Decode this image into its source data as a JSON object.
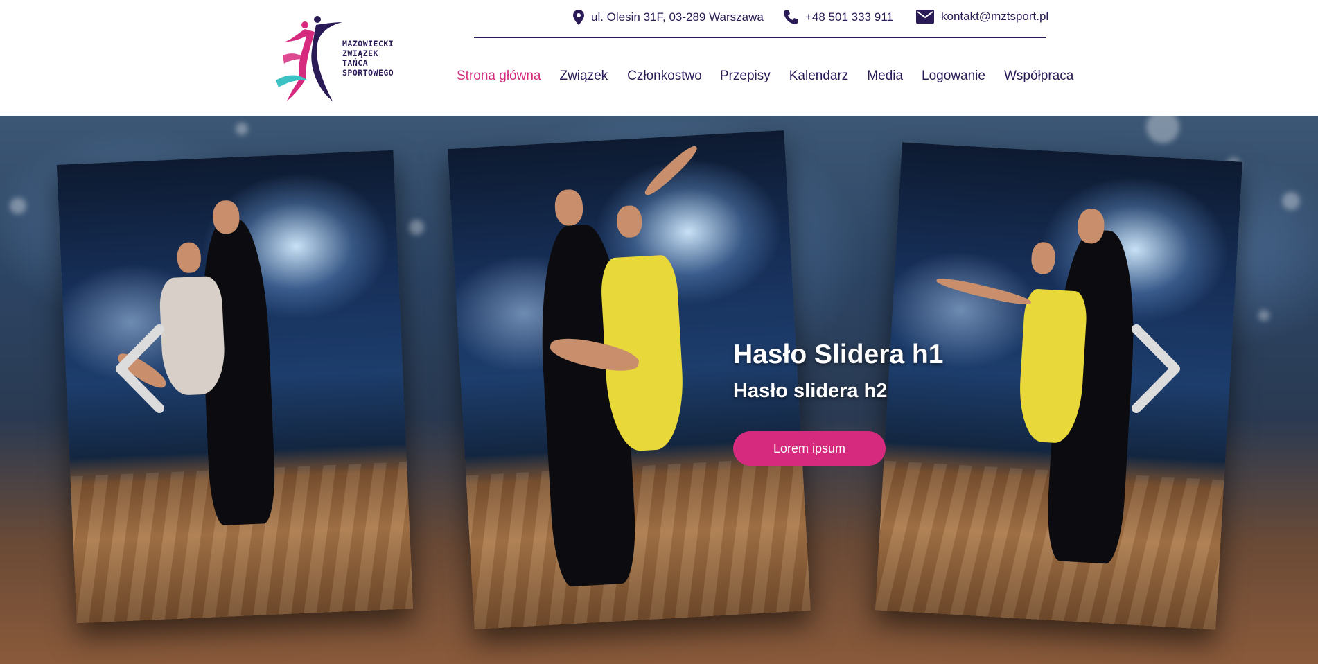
{
  "logo": {
    "lines": [
      "MAZOWIECKI",
      "ZWIĄZEK",
      "TAŃCA",
      "SPORTOWEGO"
    ],
    "colors": [
      "#d62a7e",
      "#2a1a55",
      "#3cc2c2"
    ]
  },
  "contact": {
    "address": "ul. Olesin 31F, 03-289 Warszawa",
    "address_icon": "map-pin-icon",
    "phone": "+48 501 333 911",
    "phone_icon": "phone-icon",
    "email": "kontakt@mztsport.pl",
    "email_icon": "envelope-icon"
  },
  "nav": {
    "items": [
      {
        "label": "Strona główna",
        "active": true
      },
      {
        "label": "Związek",
        "active": false
      },
      {
        "label": "Członkostwo",
        "active": false
      },
      {
        "label": "Przepisy",
        "active": false
      },
      {
        "label": "Kalendarz",
        "active": false
      },
      {
        "label": "Media",
        "active": false
      },
      {
        "label": "Logowanie",
        "active": false
      },
      {
        "label": "Współpraca",
        "active": false
      }
    ]
  },
  "slider": {
    "h1": "Hasło Slidera h1",
    "h2": "Hasło slidera h2",
    "button_label": "Lorem ipsum",
    "prev_icon": "chevron-left-icon",
    "next_icon": "chevron-right-icon"
  },
  "colors": {
    "primary": "#2a1a55",
    "accent": "#d62a7e",
    "white": "#ffffff"
  }
}
